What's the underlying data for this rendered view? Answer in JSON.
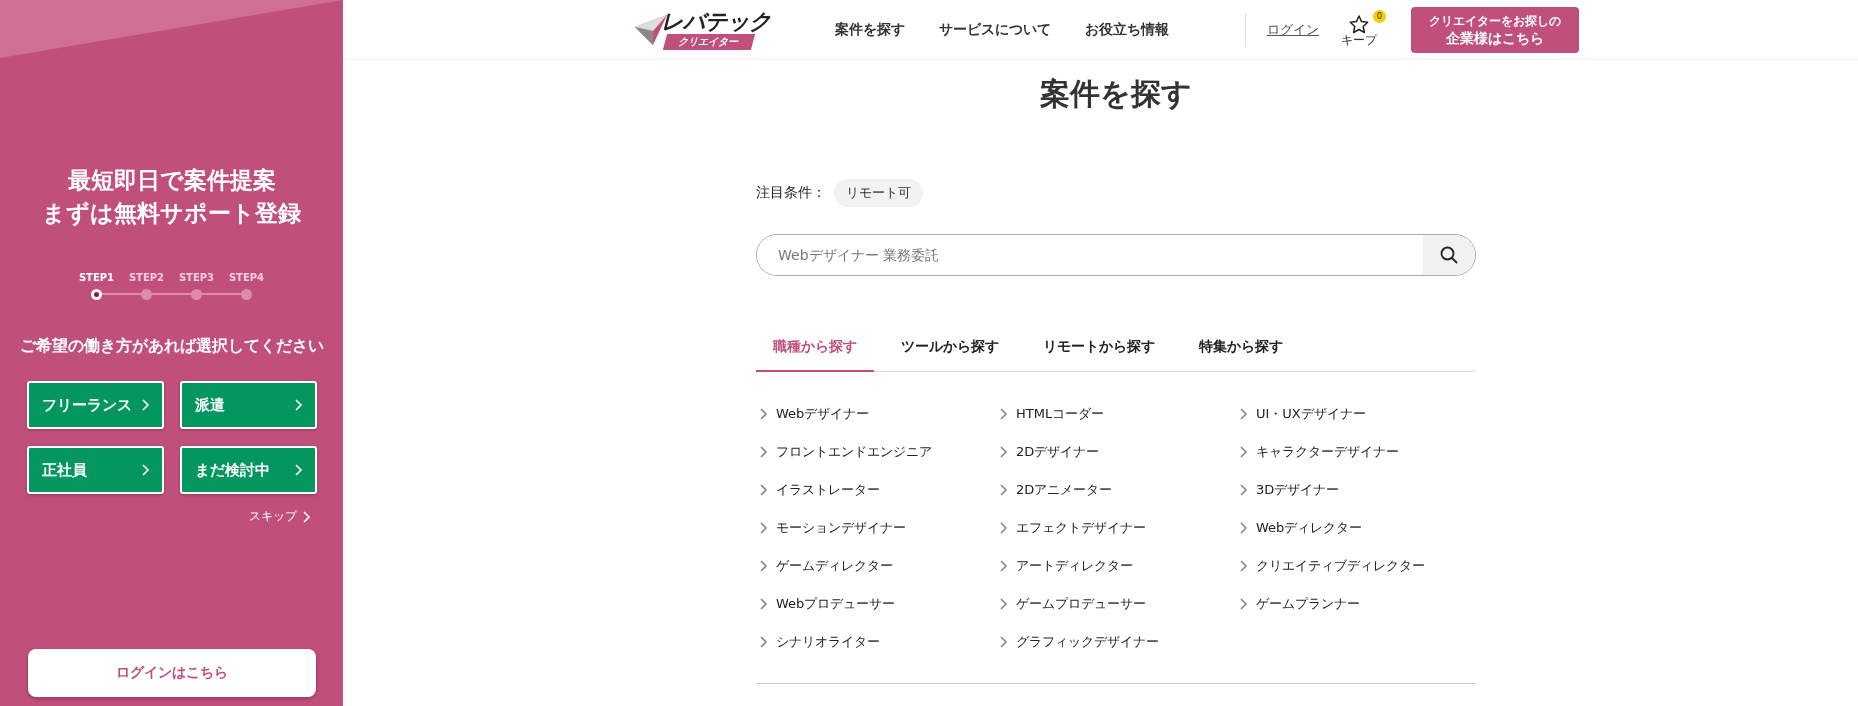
{
  "sidebar": {
    "headline": [
      "最短即日で案件提案",
      "まずは無料サポート登録"
    ],
    "steps": [
      {
        "label": "STEP1",
        "selected": true
      },
      {
        "label": "STEP2",
        "selected": false
      },
      {
        "label": "STEP3",
        "selected": false
      },
      {
        "label": "STEP4",
        "selected": false
      }
    ],
    "prompt": "ご希望の働き方があれば選択してください",
    "options": [
      {
        "label": "フリーランス"
      },
      {
        "label": "派遣"
      },
      {
        "label": "正社員"
      },
      {
        "label": "まだ検討中"
      }
    ],
    "skip": "スキップ",
    "login_button": "ログインはこちら"
  },
  "header": {
    "logo": {
      "name": "レバテック",
      "sub": "クリエイター"
    },
    "nav": [
      "案件を探す",
      "サービスについて",
      "お役立ち情報"
    ],
    "login": "ログイン",
    "keep": {
      "label": "キープ",
      "count": "0"
    },
    "cta": [
      "クリエイターをお探しの",
      "企業様はこちら"
    ]
  },
  "main": {
    "title": "案件を探す",
    "featured": {
      "label": "注目条件：",
      "tags": [
        "リモート可"
      ]
    },
    "search": {
      "placeholder": "Webデザイナー 業務委託"
    },
    "tabs": [
      {
        "label": "職種から探す",
        "selected": true
      },
      {
        "label": "ツールから探す",
        "selected": false
      },
      {
        "label": "リモートから探す",
        "selected": false
      },
      {
        "label": "特集から探す",
        "selected": false
      }
    ],
    "categories": [
      "Webデザイナー",
      "HTMLコーダー",
      "UI・UXデザイナー",
      "フロントエンドエンジニア",
      "2Dデザイナー",
      "キャラクターデザイナー",
      "イラストレーター",
      "2Dアニメーター",
      "3Dデザイナー",
      "モーションデザイナー",
      "エフェクトデザイナー",
      "Webディレクター",
      "ゲームディレクター",
      "アートディレクター",
      "クリエイティブディレクター",
      "Webプロデューサー",
      "ゲームプロデューサー",
      "ゲームプランナー",
      "シナリオライター",
      "グラフィックデザイナー"
    ]
  }
}
